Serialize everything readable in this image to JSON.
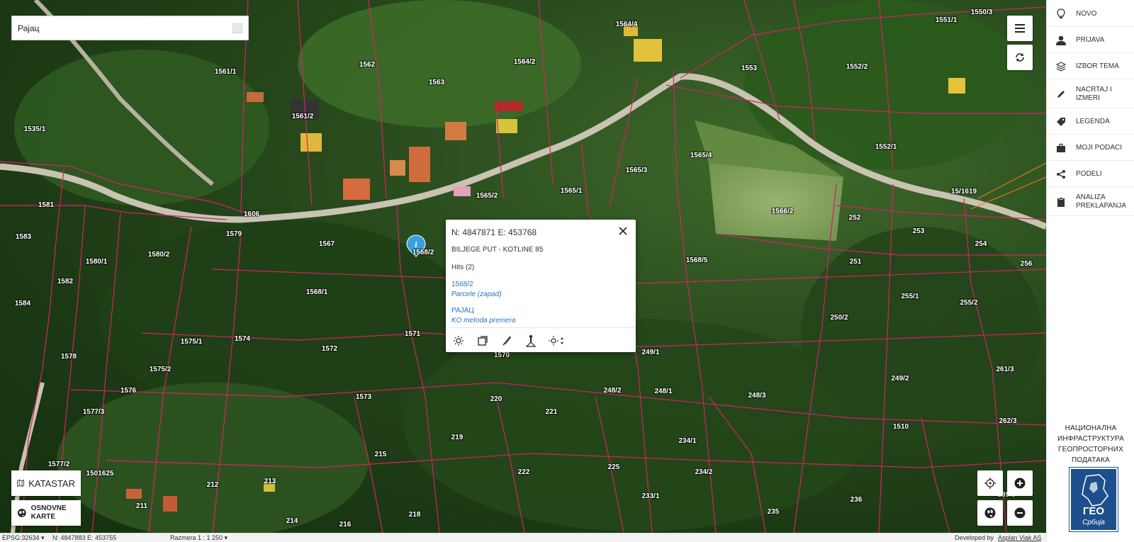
{
  "search": {
    "value": "Рајац"
  },
  "parcels": [
    "1535/1",
    "1561/1",
    "1561/2",
    "1562",
    "1563",
    "1564/2",
    "1564/4",
    "1553",
    "1552/2",
    "1551/1",
    "1550/3",
    "1581",
    "1583",
    "1606",
    "1579",
    "1567",
    "1568/2",
    "1565/2",
    "1565/1",
    "1565/3",
    "1565/4",
    "1566/2",
    "1552/1",
    "15/1619",
    "252",
    "253",
    "254",
    "256",
    "251",
    "1568/5",
    "1580/1",
    "1580/2",
    "1582",
    "1584",
    "1568/1",
    "255/1",
    "255/2",
    "250/2",
    "1575/1",
    "1574",
    "1572",
    "1571",
    "1570",
    "249/1",
    "1578",
    "1575/2",
    "1576",
    "1573",
    "220",
    "221",
    "248/2",
    "248/1",
    "248/3",
    "249/2",
    "261/3",
    "1577/3",
    "219",
    "215",
    "222",
    "225",
    "234/1",
    "234/2",
    "1510",
    "262/3",
    "1577/2",
    "1501625",
    "212",
    "213",
    "211",
    "214",
    "216",
    "218",
    "233/1",
    "235",
    "236",
    "239/3"
  ],
  "map_controls": {
    "menu": "menu-icon",
    "refresh": "refresh-icon",
    "locate": "crosshair-icon",
    "zoom_in": "plus-icon",
    "world": "globe-icon",
    "zoom_out": "minus-icon"
  },
  "basemap": {
    "katastar": "KATASTAR",
    "osnovne": "OSNOVNE KARTE"
  },
  "popup": {
    "coords": "N: 4847871 E: 453768",
    "address": "BILJEGE PUT - KOTLINE 85",
    "hits": "Hits (2)",
    "results": [
      {
        "title": "1568/2",
        "subtitle": "Parcele (zapad)"
      },
      {
        "title": "РАЈАЦ",
        "subtitle": "KO metoda premera"
      }
    ]
  },
  "sidebar": {
    "items": [
      {
        "icon": "lightbulb-icon",
        "label": "NOVO"
      },
      {
        "icon": "user-icon",
        "label": "PRIJAVA"
      },
      {
        "icon": "layers-icon",
        "label": "IZBOR TEMA"
      },
      {
        "icon": "pencil-icon",
        "label": "NACRTAJ I IZMERI"
      },
      {
        "icon": "tag-icon",
        "label": "LEGENDA"
      },
      {
        "icon": "briefcase-icon",
        "label": "MOJI PODACI"
      },
      {
        "icon": "share-icon",
        "label": "PODELI"
      },
      {
        "icon": "clipboard-icon",
        "label": "ANALIZA PREKLAPANJA"
      }
    ],
    "org": [
      "НАЦИОНАЛНА",
      "ИНФРАСТРУКТУРА",
      "ГЕОПРОСТОРНИХ",
      "ПОДАТАКА"
    ],
    "logo_main": "ГЕО",
    "logo_sub": "Србија"
  },
  "status": {
    "epsg": "EPSG:32634 ▾",
    "coords": "N: 4847883 E: 453755",
    "scale": "Razmera 1 : 1 250 ▾",
    "developed": "Developed by",
    "company": "Asplan Viak AS"
  },
  "colors": {
    "parcel_line": "#d6206a",
    "road": "#c9c3b2",
    "accent": "#2b73b4",
    "marker": "#3a9fe0"
  }
}
